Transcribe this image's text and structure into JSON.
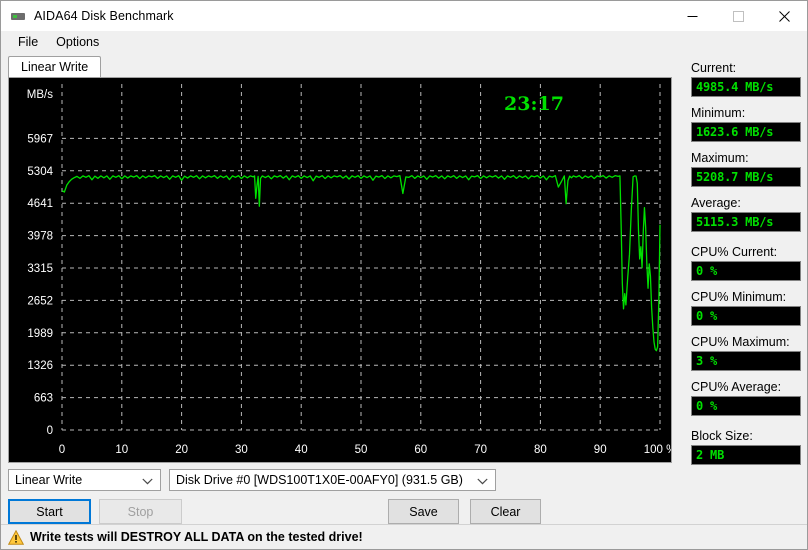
{
  "window": {
    "title": "AIDA64 Disk Benchmark",
    "icon": "disk-drive-icon",
    "minimize_label": "Minimize",
    "maximize_label": "Maximize",
    "close_label": "Close"
  },
  "menu": {
    "items": [
      {
        "label": "File"
      },
      {
        "label": "Options"
      }
    ]
  },
  "tabs": [
    {
      "label": "Linear Write",
      "active": true
    }
  ],
  "chart_data": {
    "type": "line",
    "title": "",
    "timer": "23:17",
    "xlabel": "",
    "ylabel": "MB/s",
    "xlim": [
      0,
      100
    ],
    "ylim": [
      0,
      6630
    ],
    "grid": true,
    "line_color": "#00e000",
    "grid_color": "#b9b9b9",
    "background": "#000000",
    "axis_text_color": "#ffffff",
    "xticks": [
      0,
      10,
      20,
      30,
      40,
      50,
      60,
      70,
      80,
      90,
      100
    ],
    "xticklabels": [
      "0",
      "10",
      "20",
      "30",
      "40",
      "50",
      "60",
      "70",
      "80",
      "90",
      "100 %"
    ],
    "yticks": [
      0,
      663,
      1326,
      1989,
      2652,
      3315,
      3978,
      4641,
      5304,
      5967
    ],
    "yticklabels": [
      "0",
      "663",
      "1326",
      "1989",
      "2652",
      "3315",
      "3978",
      "4641",
      "5304",
      "5967"
    ],
    "series": [
      {
        "name": "Linear Write",
        "x": [
          0.0,
          0.4,
          0.8,
          1.2,
          1.6,
          2.0,
          2.5,
          3.0,
          3.5,
          4.0,
          4.5,
          5.0,
          5.5,
          6.0,
          6.5,
          7.0,
          7.5,
          8.0,
          8.5,
          9.0,
          9.5,
          10.0,
          10.5,
          11.0,
          11.5,
          12.0,
          12.5,
          13.0,
          13.5,
          14.0,
          14.5,
          15.0,
          15.5,
          16.0,
          16.5,
          17.0,
          17.5,
          18.0,
          18.5,
          19.0,
          19.5,
          20.0,
          20.5,
          21.0,
          21.5,
          22.0,
          22.5,
          23.0,
          23.5,
          24.0,
          24.5,
          25.0,
          25.5,
          26.0,
          26.5,
          27.0,
          27.5,
          28.0,
          28.5,
          29.0,
          29.5,
          30.0,
          30.5,
          31.0,
          31.5,
          32.0,
          32.2,
          32.4,
          32.6,
          32.8,
          33.0,
          33.2,
          33.5,
          34.0,
          34.5,
          35.0,
          35.5,
          36.0,
          36.5,
          37.0,
          37.5,
          38.0,
          38.5,
          39.0,
          39.5,
          40.0,
          40.5,
          41.0,
          41.5,
          42.0,
          42.5,
          43.0,
          43.5,
          44.0,
          44.5,
          45.0,
          45.5,
          46.0,
          46.5,
          47.0,
          47.5,
          48.0,
          48.5,
          49.0,
          49.5,
          50.0,
          50.5,
          51.0,
          51.5,
          52.0,
          52.5,
          53.0,
          53.5,
          54.0,
          54.5,
          55.0,
          55.5,
          56.0,
          56.5,
          57.0,
          57.5,
          58.0,
          58.5,
          59.0,
          59.5,
          60.0,
          60.5,
          61.0,
          61.5,
          62.0,
          62.5,
          63.0,
          63.5,
          64.0,
          64.5,
          65.0,
          65.5,
          66.0,
          66.5,
          67.0,
          67.5,
          68.0,
          68.5,
          69.0,
          69.5,
          70.0,
          70.5,
          71.0,
          71.5,
          72.0,
          72.5,
          73.0,
          73.5,
          74.0,
          74.5,
          75.0,
          75.5,
          76.0,
          76.5,
          77.0,
          77.5,
          78.0,
          78.5,
          79.0,
          79.5,
          80.0,
          80.5,
          81.0,
          81.5,
          82.0,
          82.5,
          83.0,
          83.5,
          84.0,
          84.3,
          84.6,
          84.9,
          85.2,
          85.5,
          86.0,
          86.5,
          87.0,
          87.5,
          88.0,
          88.5,
          89.0,
          89.5,
          90.0,
          90.5,
          91.0,
          91.5,
          92.0,
          92.5,
          93.0,
          93.3,
          93.5,
          93.7,
          93.9,
          94.1,
          94.3,
          94.6,
          94.9,
          95.2,
          95.5,
          95.8,
          96.0,
          96.2,
          96.4,
          96.6,
          96.8,
          97.0,
          97.2,
          97.4,
          97.6,
          97.8,
          98.0,
          98.2,
          98.4,
          98.6,
          98.8,
          99.0,
          99.2,
          99.4,
          99.6,
          99.8,
          100.0
        ],
        "values": [
          4900,
          4870,
          5010,
          5080,
          5130,
          5160,
          5190,
          5150,
          5200,
          5170,
          5205,
          5120,
          5195,
          5150,
          5200,
          5160,
          5200,
          5130,
          5200,
          5170,
          5205,
          5140,
          5200,
          5155,
          5200,
          5175,
          5205,
          5145,
          5200,
          5160,
          5200,
          5180,
          5205,
          5150,
          5200,
          5165,
          5200,
          5130,
          5200,
          5170,
          5205,
          5110,
          5195,
          5155,
          5200,
          5170,
          5205,
          5140,
          5200,
          5160,
          5200,
          5175,
          5205,
          5150,
          5200,
          5165,
          5200,
          5125,
          5200,
          5170,
          5205,
          5145,
          5200,
          5160,
          5200,
          5180,
          5200,
          4740,
          5000,
          5190,
          4580,
          5150,
          5200,
          5165,
          5200,
          5140,
          5200,
          5175,
          5205,
          5155,
          5200,
          5120,
          5200,
          5170,
          5205,
          5150,
          5200,
          5165,
          5200,
          5100,
          5195,
          5170,
          5205,
          5145,
          5200,
          5160,
          5200,
          5180,
          5205,
          5155,
          5200,
          5135,
          5200,
          5170,
          5205,
          5150,
          5200,
          5165,
          5200,
          5110,
          5195,
          5175,
          5205,
          5145,
          5200,
          5160,
          5200,
          5185,
          5205,
          4840,
          5180,
          5170,
          5205,
          5150,
          5200,
          5165,
          5200,
          5130,
          5200,
          5175,
          5205,
          5155,
          5200,
          5140,
          5200,
          5170,
          5205,
          5150,
          5200,
          5165,
          5200,
          5120,
          5195,
          5180,
          5205,
          5145,
          5200,
          5160,
          5200,
          5175,
          5205,
          5155,
          5200,
          5130,
          5200,
          5170,
          5205,
          5150,
          5200,
          5165,
          5200,
          5140,
          5200,
          5180,
          5205,
          5155,
          5200,
          5120,
          5195,
          5175,
          5205,
          4970,
          5080,
          5200,
          4630,
          5100,
          5195,
          5160,
          5200,
          5175,
          5205,
          5150,
          5200,
          5165,
          5200,
          5145,
          5200,
          5180,
          5205,
          5155,
          5200,
          5170,
          5205,
          5190,
          5200,
          4200,
          3000,
          2480,
          2790,
          2560,
          3120,
          3600,
          4500,
          5180,
          5200,
          5195,
          5050,
          4100,
          3500,
          3750,
          3320,
          4050,
          4550,
          4150,
          3400,
          2900,
          3400,
          3150,
          2500,
          2100,
          1800,
          1650,
          1623,
          1700,
          2600,
          4200,
          5150
        ]
      }
    ]
  },
  "stats": [
    {
      "label": "Current:",
      "value": "4985.4 MB/s",
      "name": "current"
    },
    {
      "label": "Minimum:",
      "value": "1623.6 MB/s",
      "name": "minimum"
    },
    {
      "label": "Maximum:",
      "value": "5208.7 MB/s",
      "name": "maximum"
    },
    {
      "label": "Average:",
      "value": "5115.3 MB/s",
      "name": "average"
    },
    {
      "label": "CPU% Current:",
      "value": "0 %",
      "name": "cpu-current"
    },
    {
      "label": "CPU% Minimum:",
      "value": "0 %",
      "name": "cpu-minimum"
    },
    {
      "label": "CPU% Maximum:",
      "value": "3 %",
      "name": "cpu-maximum"
    },
    {
      "label": "CPU% Average:",
      "value": "0 %",
      "name": "cpu-average"
    },
    {
      "label": "Block Size:",
      "value": "2 MB",
      "name": "block-size"
    }
  ],
  "controls": {
    "test_mode": {
      "value": "Linear Write"
    },
    "drive": {
      "value": "Disk Drive #0  [WDS100T1X0E-00AFY0]  (931.5 GB)"
    },
    "start_label": "Start",
    "stop_label": "Stop",
    "save_label": "Save",
    "clear_label": "Clear"
  },
  "status": {
    "icon": "warning-triangle-icon",
    "text": "Write tests will DESTROY ALL DATA on the tested drive!"
  },
  "colors": {
    "accent": "#0078d7",
    "graph_line": "#00e000",
    "graph_bg": "#000000",
    "value_text": "#00e000",
    "warning": "#ffc000"
  }
}
